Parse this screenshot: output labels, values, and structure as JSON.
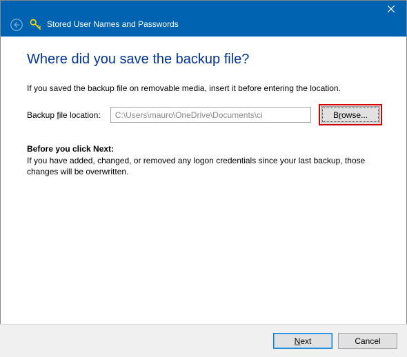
{
  "titlebar": {
    "title": "Stored User Names and Passwords"
  },
  "content": {
    "heading": "Where did you save the backup file?",
    "instruction": "If you saved the backup file on removable media, insert it before entering the location.",
    "field_label_pre": "Backup ",
    "field_label_u": "f",
    "field_label_post": "ile location:",
    "path_value": "C:\\Users\\mauro\\OneDrive\\Documents\\ci",
    "browse_pre": "B",
    "browse_u": "r",
    "browse_post": "owse...",
    "subheading": "Before you click Next:",
    "subtext": "If you have added, changed, or removed any logon credentials since your last backup, those changes will be overwritten."
  },
  "footer": {
    "next_u": "N",
    "next_post": "ext",
    "cancel": "Cancel"
  }
}
